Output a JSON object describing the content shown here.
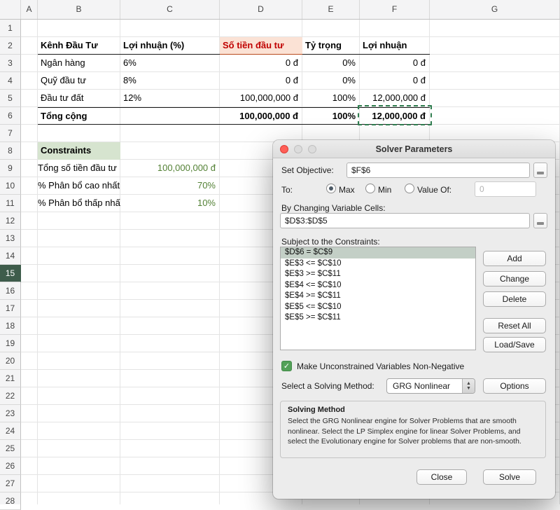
{
  "spreadsheet": {
    "col_headers": [
      "A",
      "B",
      "C",
      "D",
      "E",
      "F",
      "G"
    ],
    "row_count": 28,
    "selected_row_header": "15",
    "table": {
      "headers": {
        "b": "Kênh Đầu Tư",
        "c": "Lợi nhuận (%)",
        "d": "Số tiền đầu tư",
        "e": "Tỷ trọng",
        "f": "Lợi nhuận"
      },
      "rows": [
        {
          "b": "Ngân hàng",
          "c": "6%",
          "d": "0 đ",
          "e": "0%",
          "f": "0 đ"
        },
        {
          "b": "Quỹ đầu tư",
          "c": "8%",
          "d": "0 đ",
          "e": "0%",
          "f": "0 đ"
        },
        {
          "b": "Đầu tư đất",
          "c": "12%",
          "d": "100,000,000 đ",
          "e": "100%",
          "f": "12,000,000 đ"
        }
      ],
      "total": {
        "b": "Tổng cộng",
        "d": "100,000,000 đ",
        "e": "100%",
        "f": "12,000,000 đ"
      }
    },
    "constraints_block": {
      "title": "Constraints",
      "rows": [
        {
          "label": "Tổng số tiền đầu tư",
          "value": "100,000,000 đ"
        },
        {
          "label": "% Phân bổ cao nhất",
          "value": "70%"
        },
        {
          "label": "% Phân bổ thấp nhất",
          "value": "10%"
        }
      ]
    }
  },
  "dialog": {
    "title": "Solver Parameters",
    "set_objective_label": "Set Objective:",
    "set_objective_value": "$F$6",
    "to_label": "To:",
    "radio_max": "Max",
    "radio_min": "Min",
    "radio_value_of": "Value Of:",
    "value_of_value": "0",
    "by_changing_label": "By Changing Variable Cells:",
    "by_changing_value": "$D$3:$D$5",
    "constraints_label": "Subject to the Constraints:",
    "constraints": [
      "$D$6 = $C$9",
      "$E$3 <= $C$10",
      "$E$3 >= $C$11",
      "$E$4 <= $C$10",
      "$E$4 >= $C$11",
      "$E$5 <= $C$10",
      "$E$5 >= $C$11"
    ],
    "selected_constraint_index": 0,
    "checkbox_label": "Make Unconstrained Variables Non-Negative",
    "checkbox_checked": true,
    "solving_method_label": "Select a Solving Method:",
    "solving_method_value": "GRG Nonlinear",
    "solving_method_box_title": "Solving Method",
    "solving_method_description": "Select the GRG Nonlinear engine for Solver Problems that are smooth nonlinear. Select the LP Simplex engine for linear Solver Problems, and select the Evolutionary engine for Solver problems that are non-smooth.",
    "buttons": {
      "add": "Add",
      "change": "Change",
      "delete": "Delete",
      "reset_all": "Reset All",
      "load_save": "Load/Save",
      "options": "Options",
      "close": "Close",
      "solve": "Solve"
    }
  },
  "colors": {
    "investment_header_bg": "#fbe2d5",
    "investment_header_text": "#c00000",
    "constraints_title_bg": "#d6e4cf",
    "constraint_value_text": "#538135",
    "marching_ants": "#2f7d4f",
    "checkbox_accent": "#53a158",
    "selected_row_header_bg": "#3e5c4b"
  }
}
